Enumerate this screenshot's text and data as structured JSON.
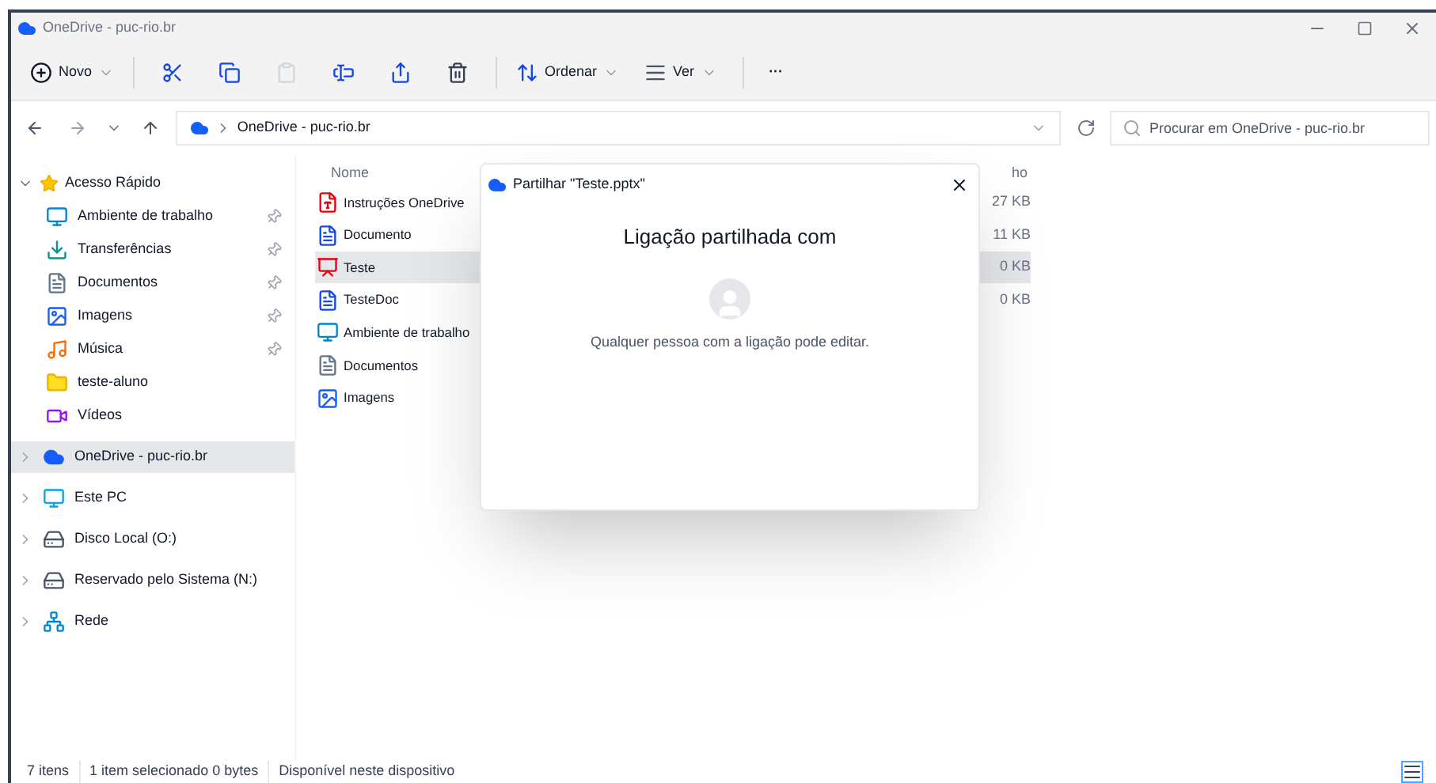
{
  "window": {
    "title": "OneDrive - puc-rio.br"
  },
  "toolbar": {
    "new_label": "Novo",
    "sort_label": "Ordenar",
    "view_label": "Ver",
    "more": "···"
  },
  "address": {
    "path": "OneDrive - puc-rio.br",
    "search_placeholder": "Procurar em OneDrive - puc-rio.br"
  },
  "sidebar": {
    "quick_access": {
      "label": "Acesso Rápido",
      "expanded": true,
      "children": [
        {
          "label": "Ambiente de trabalho",
          "kind": "desktop",
          "pinned": true
        },
        {
          "label": "Transferências",
          "kind": "download",
          "pinned": true
        },
        {
          "label": "Documentos",
          "kind": "docs",
          "pinned": true
        },
        {
          "label": "Imagens",
          "kind": "images",
          "pinned": true
        },
        {
          "label": "Música",
          "kind": "music",
          "pinned": true
        },
        {
          "label": "teste-aluno",
          "kind": "folder",
          "pinned": false
        },
        {
          "label": "Vídeos",
          "kind": "videos",
          "pinned": false
        }
      ]
    },
    "roots": [
      {
        "label": "OneDrive - puc-rio.br",
        "kind": "cloud",
        "selected": true
      },
      {
        "label": "Este PC",
        "kind": "pc",
        "selected": false
      },
      {
        "label": "Disco Local (O:)",
        "kind": "drive",
        "selected": false
      },
      {
        "label": "Reservado pelo Sistema (N:)",
        "kind": "drive",
        "selected": false
      },
      {
        "label": "Rede",
        "kind": "network",
        "selected": false
      }
    ]
  },
  "table": {
    "columns": [
      "Nome",
      "ho"
    ],
    "rows": [
      {
        "name": "Instruções OneDrive",
        "kind": "pdf",
        "size": "27 KB",
        "selected": false
      },
      {
        "name": "Documento",
        "kind": "word",
        "size": "11 KB",
        "selected": false
      },
      {
        "name": "Teste",
        "kind": "ppt",
        "size": "0 KB",
        "selected": true
      },
      {
        "name": "TesteDoc",
        "kind": "word",
        "size": "0 KB",
        "selected": false
      },
      {
        "name": "Ambiente de trabalho",
        "kind": "desktop",
        "selected": false
      },
      {
        "name": "Documentos",
        "kind": "docs",
        "selected": false
      },
      {
        "name": "Imagens",
        "kind": "images",
        "selected": false
      }
    ]
  },
  "dialog": {
    "title": "Partilhar \"Teste.pptx\"",
    "heading": "Ligação partilhada com",
    "message": "Qualquer pessoa com a ligação pode editar."
  },
  "status_bar": [
    "7 itens",
    "1 item selecionado 0 bytes",
    "Disponível neste dispositivo"
  ]
}
